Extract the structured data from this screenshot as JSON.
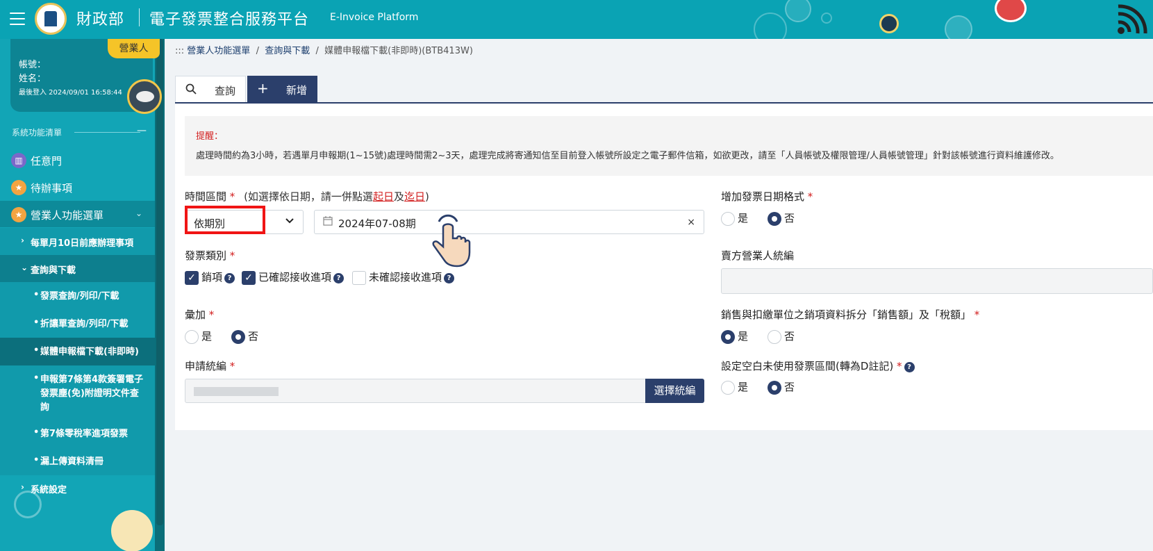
{
  "header": {
    "org": "財政部",
    "title": "電子發票整合服務平台",
    "title_en": "E-Invoice Platform"
  },
  "user": {
    "role_badge": "營業人",
    "account_label": "帳號：",
    "name_label": "姓名：",
    "last_login": "最後登入 2024/09/01 16:58:44"
  },
  "sidebar": {
    "section_label": "系統功能清單",
    "items": [
      {
        "label": "任意門",
        "icon": "map-icon"
      },
      {
        "label": "待辦事項",
        "icon": "star-icon"
      },
      {
        "label": "營業人功能選單",
        "icon": "star-icon"
      }
    ],
    "sub_items": [
      {
        "label": "每單月10日前應辦理事項"
      },
      {
        "label": "查詢與下載"
      }
    ],
    "leaf_items": [
      {
        "label": "發票查詢/列印/下載"
      },
      {
        "label": "折讓單查詢/列印/下載"
      },
      {
        "label": "媒體申報檔下載(非即時)"
      },
      {
        "label": "申報第7條第4款簽署電子發票塵(免)附證明文件查詢"
      },
      {
        "label": "第7條零稅率進項發票"
      },
      {
        "label": "漏上傳資料清冊"
      }
    ],
    "settings": {
      "label": "系統設定"
    }
  },
  "breadcrumb": {
    "prefix": ":::",
    "level1": "營業人功能選單",
    "sep": "/",
    "level2": "查詢與下載",
    "level3": "媒體申報檔下載(非即時)(BTB413W)"
  },
  "tabs": {
    "query": "查詢",
    "add": "新增"
  },
  "notice": {
    "title": "提醒：",
    "text": "處理時間約為3小時，若遇單月申報期(1~15號)處理時間需2~3天，處理完成將寄通知信至目前登入帳號所設定之電子郵件信箱，如欲更改，請至「人員帳號及權限管理/人員帳號管理」針對該帳號進行資料維護修改。"
  },
  "form": {
    "period": {
      "label": "時間區間",
      "req": "*",
      "hint_prefix": "(如選擇依日期，請一併點選",
      "hint_start": "起日",
      "hint_and": "及",
      "hint_end": "迄日",
      "hint_suffix": ")",
      "select_value": "依期別",
      "date_value": "2024年07-08期",
      "clear": "×"
    },
    "invoice_type": {
      "label": "發票類別",
      "req": "*",
      "options": [
        {
          "label": "銷項",
          "checked": true
        },
        {
          "label": "已確認接收進項",
          "checked": true
        },
        {
          "label": "未確認接收進項",
          "checked": false
        }
      ]
    },
    "aggregate": {
      "label": "彙加",
      "req": "*",
      "yes": "是",
      "no": "否",
      "selected": "否"
    },
    "apply_ban": {
      "label": "申請統編",
      "req": "*",
      "button": "選擇統編"
    },
    "add_date_format": {
      "label": "增加發票日期格式",
      "req": "*",
      "yes": "是",
      "no": "否",
      "selected": "否"
    },
    "seller_ban": {
      "label": "賣方營業人統編",
      "value": ""
    },
    "split_sales": {
      "label": "銷售與扣繳單位之銷項資料拆分「銷售額」及「稅額」",
      "req": "*",
      "yes": "是",
      "no": "否",
      "selected": "是"
    },
    "blank_unused": {
      "label": "設定空白未使用發票區間(轉為D註記)",
      "req": "*",
      "yes": "是",
      "no": "否",
      "selected": "否"
    }
  },
  "colors": {
    "header_bg": "#0aa3b4",
    "sidebar_bg": "#12a5b6",
    "primary": "#2b3f6b",
    "required": "#d21d1d",
    "highlight": "#f01515"
  }
}
